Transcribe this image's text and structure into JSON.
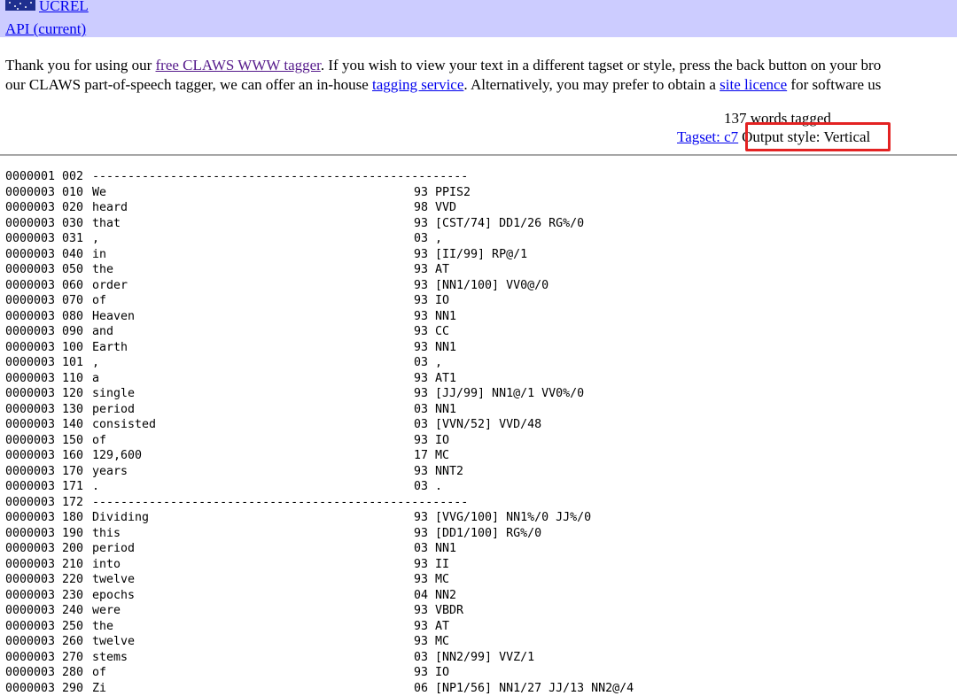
{
  "header": {
    "logo_text": "UCREL",
    "api_link": "API (current)"
  },
  "intro": {
    "line1_pre": "Thank you for using our ",
    "line1_link": "free CLAWS WWW tagger",
    "line1_post": ". If you wish to view your text in a different tagset or style, press the back button on your bro",
    "line2_pre": "our CLAWS part-of-speech tagger, we can offer an in-house ",
    "line2_link1": "tagging service",
    "line2_mid": ". Alternatively, you may prefer to obtain a ",
    "line2_link2": "site licence",
    "line2_post": " for software us"
  },
  "summary": {
    "words_tagged": "137 words tagged",
    "tagset": "Tagset: c7",
    "output_style": "Output style: Vertical"
  },
  "rows": [
    {
      "ref": "0000001 002",
      "word": "-----------------------------------------------------",
      "tags": ""
    },
    {
      "ref": "0000003 010",
      "word": "We",
      "tags": "93 PPIS2"
    },
    {
      "ref": "0000003 020",
      "word": "heard",
      "tags": "98 VVD"
    },
    {
      "ref": "0000003 030",
      "word": "that",
      "tags": "93 [CST/74] DD1/26 RG%/0"
    },
    {
      "ref": "0000003 031",
      "word": ",",
      "tags": "03 ,"
    },
    {
      "ref": "0000003 040",
      "word": "in",
      "tags": "93 [II/99] RP@/1"
    },
    {
      "ref": "0000003 050",
      "word": "the",
      "tags": "93 AT"
    },
    {
      "ref": "0000003 060",
      "word": "order",
      "tags": "93 [NN1/100] VV0@/0"
    },
    {
      "ref": "0000003 070",
      "word": "of",
      "tags": "93 IO"
    },
    {
      "ref": "0000003 080",
      "word": "Heaven",
      "tags": "93 NN1"
    },
    {
      "ref": "0000003 090",
      "word": "and",
      "tags": "93 CC"
    },
    {
      "ref": "0000003 100",
      "word": "Earth",
      "tags": "93 NN1"
    },
    {
      "ref": "0000003 101",
      "word": ",",
      "tags": "03 ,"
    },
    {
      "ref": "0000003 110",
      "word": "a",
      "tags": "93 AT1"
    },
    {
      "ref": "0000003 120",
      "word": "single",
      "tags": "93 [JJ/99] NN1@/1 VV0%/0"
    },
    {
      "ref": "0000003 130",
      "word": "period",
      "tags": "03 NN1"
    },
    {
      "ref": "0000003 140",
      "word": "consisted",
      "tags": "03 [VVN/52] VVD/48"
    },
    {
      "ref": "0000003 150",
      "word": "of",
      "tags": "93 IO"
    },
    {
      "ref": "0000003 160",
      "word": "129,600",
      "tags": "17 MC"
    },
    {
      "ref": "0000003 170",
      "word": "years",
      "tags": "93 NNT2"
    },
    {
      "ref": "0000003 171",
      "word": ".",
      "tags": "03 ."
    },
    {
      "ref": "0000003 172",
      "word": "-----------------------------------------------------",
      "tags": ""
    },
    {
      "ref": "0000003 180",
      "word": "Dividing",
      "tags": "93 [VVG/100] NN1%/0 JJ%/0"
    },
    {
      "ref": "0000003 190",
      "word": "this",
      "tags": "93 [DD1/100] RG%/0"
    },
    {
      "ref": "0000003 200",
      "word": "period",
      "tags": "03 NN1"
    },
    {
      "ref": "0000003 210",
      "word": "into",
      "tags": "93 II"
    },
    {
      "ref": "0000003 220",
      "word": "twelve",
      "tags": "93 MC"
    },
    {
      "ref": "0000003 230",
      "word": "epochs",
      "tags": "04 NN2"
    },
    {
      "ref": "0000003 240",
      "word": "were",
      "tags": "93 VBDR"
    },
    {
      "ref": "0000003 250",
      "word": "the",
      "tags": "93 AT"
    },
    {
      "ref": "0000003 260",
      "word": "twelve",
      "tags": "93 MC"
    },
    {
      "ref": "0000003 270",
      "word": "stems",
      "tags": "03 [NN2/99] VVZ/1"
    },
    {
      "ref": "0000003 280",
      "word": "of",
      "tags": "93 IO"
    },
    {
      "ref": "0000003 290",
      "word": "Zi",
      "tags": "06 [NP1/56] NN1/27 JJ/13 NN2@/4"
    }
  ]
}
